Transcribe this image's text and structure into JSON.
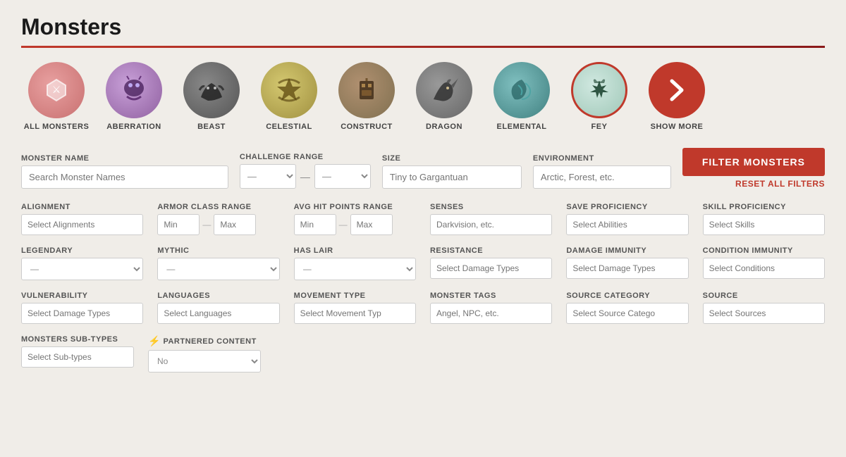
{
  "page": {
    "title": "Monsters"
  },
  "monster_types": [
    {
      "id": "all",
      "label": "ALL MONSTERS",
      "circle_class": "circle-all",
      "icon": "shield"
    },
    {
      "id": "aberration",
      "label": "ABERRATION",
      "circle_class": "circle-aberration",
      "icon": "bug"
    },
    {
      "id": "beast",
      "label": "BEAST",
      "circle_class": "circle-beast",
      "icon": "paw"
    },
    {
      "id": "celestial",
      "label": "CELESTIAL",
      "circle_class": "circle-celestial",
      "icon": "star"
    },
    {
      "id": "construct",
      "label": "CONSTRUCT",
      "circle_class": "circle-construct",
      "icon": "gear"
    },
    {
      "id": "dragon",
      "label": "DRAGON",
      "circle_class": "circle-dragon",
      "icon": "dragon"
    },
    {
      "id": "elemental",
      "label": "ELEMENTAL",
      "circle_class": "circle-elemental",
      "icon": "wave"
    },
    {
      "id": "fey",
      "label": "FEY",
      "circle_class": "circle-fey",
      "icon": "fairy",
      "selected": true
    },
    {
      "id": "showmore",
      "label": "SHOW MORE",
      "circle_class": "circle-showmore",
      "icon": "arrow"
    }
  ],
  "filters": {
    "monster_name": {
      "label": "MONSTER NAME",
      "placeholder": "Search Monster Names"
    },
    "challenge_range": {
      "label": "CHALLENGE RANGE",
      "dash": "—"
    },
    "size": {
      "label": "SIZE",
      "placeholder": "Tiny to Gargantuan"
    },
    "environment": {
      "label": "ENVIRONMENT",
      "placeholder": "Arctic, Forest, etc."
    },
    "filter_button": "FILTER MONSTERS",
    "reset_link": "RESET ALL FILTERS",
    "alignment": {
      "label": "ALIGNMENT",
      "placeholder": "Select Alignments"
    },
    "armor_class_range": {
      "label": "ARMOR CLASS RANGE",
      "min_placeholder": "Min",
      "max_placeholder": "Max"
    },
    "avg_hit_points": {
      "label": "AVG HIT POINTS RANGE",
      "min_placeholder": "Min",
      "max_placeholder": "Max"
    },
    "senses": {
      "label": "SENSES",
      "placeholder": "Darkvision, etc."
    },
    "save_proficiency": {
      "label": "SAVE PROFICIENCY",
      "placeholder": "Select Abilities"
    },
    "skill_proficiency": {
      "label": "SKILL PROFICIENCY",
      "placeholder": "Select Skills"
    },
    "legendary": {
      "label": "LEGENDARY",
      "default": "—"
    },
    "mythic": {
      "label": "MYTHIC",
      "default": "—"
    },
    "has_lair": {
      "label": "HAS LAIR",
      "default": "—"
    },
    "resistance": {
      "label": "RESISTANCE",
      "placeholder": "Select Damage Types"
    },
    "damage_immunity": {
      "label": "DAMAGE IMMUNITY",
      "placeholder": "Select Damage Types"
    },
    "condition_immunity": {
      "label": "CONDITION IMMUNITY",
      "placeholder": "Select Conditions"
    },
    "vulnerability": {
      "label": "VULNERABILITY",
      "placeholder": "Select Damage Types"
    },
    "languages": {
      "label": "LANGUAGES",
      "placeholder": "Select Languages"
    },
    "movement_type": {
      "label": "MOVEMENT TYPE",
      "placeholder": "Select Movement Typ"
    },
    "monster_tags": {
      "label": "MONSTER TAGS",
      "placeholder": "Angel, NPC, etc."
    },
    "source_category": {
      "label": "SOURCE CATEGORY",
      "placeholder": "Select Source Catego"
    },
    "source": {
      "label": "SOURCE",
      "placeholder": "Select Sources"
    },
    "monsters_sub_types": {
      "label": "MONSTERS SUB-TYPES",
      "placeholder": "Select Sub-types"
    },
    "partnered_content": {
      "label": "PARTNERED CONTENT",
      "default": "No"
    }
  }
}
